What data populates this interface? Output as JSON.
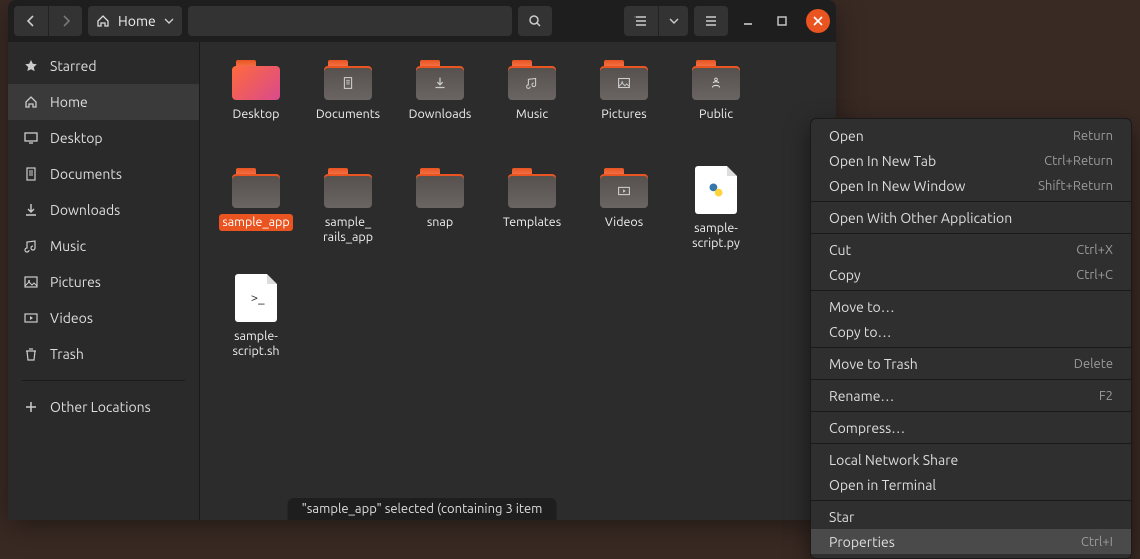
{
  "path": {
    "label": "Home"
  },
  "sidebar": {
    "items": [
      {
        "label": "Starred",
        "icon": "star"
      },
      {
        "label": "Home",
        "icon": "home",
        "active": true
      },
      {
        "label": "Desktop",
        "icon": "desktop"
      },
      {
        "label": "Documents",
        "icon": "documents"
      },
      {
        "label": "Downloads",
        "icon": "downloads"
      },
      {
        "label": "Music",
        "icon": "music"
      },
      {
        "label": "Pictures",
        "icon": "pictures"
      },
      {
        "label": "Videos",
        "icon": "videos"
      },
      {
        "label": "Trash",
        "icon": "trash"
      }
    ],
    "other": {
      "label": "Other Locations"
    }
  },
  "grid": {
    "items": [
      {
        "label": "Desktop",
        "type": "folder-special"
      },
      {
        "label": "Documents",
        "type": "folder",
        "glyph": "documents"
      },
      {
        "label": "Downloads",
        "type": "folder",
        "glyph": "downloads"
      },
      {
        "label": "Music",
        "type": "folder",
        "glyph": "music"
      },
      {
        "label": "Pictures",
        "type": "folder",
        "glyph": "pictures"
      },
      {
        "label": "Public",
        "type": "folder",
        "glyph": "public"
      },
      {
        "label": "sample_app",
        "type": "folder",
        "selected": true
      },
      {
        "label": "sample_rails_app",
        "type": "folder"
      },
      {
        "label": "snap",
        "type": "folder"
      },
      {
        "label": "Templates",
        "type": "folder"
      },
      {
        "label": "Videos",
        "type": "folder",
        "glyph": "videos"
      },
      {
        "label": "sample-script.py",
        "type": "file",
        "glyph": "python"
      },
      {
        "label": "sample-script.sh",
        "type": "file",
        "glyph": "shell"
      }
    ]
  },
  "statusbar": {
    "text": "\"sample_app\" selected  (containing 3 item"
  },
  "context_menu": {
    "groups": [
      [
        {
          "label": "Open",
          "shortcut": "Return"
        },
        {
          "label": "Open In New Tab",
          "shortcut": "Ctrl+Return"
        },
        {
          "label": "Open In New Window",
          "shortcut": "Shift+Return"
        }
      ],
      [
        {
          "label": "Open With Other Application"
        }
      ],
      [
        {
          "label": "Cut",
          "shortcut": "Ctrl+X"
        },
        {
          "label": "Copy",
          "shortcut": "Ctrl+C"
        }
      ],
      [
        {
          "label": "Move to…"
        },
        {
          "label": "Copy to…"
        }
      ],
      [
        {
          "label": "Move to Trash",
          "shortcut": "Delete"
        }
      ],
      [
        {
          "label": "Rename…",
          "shortcut": "F2"
        }
      ],
      [
        {
          "label": "Compress…"
        }
      ],
      [
        {
          "label": "Local Network Share"
        },
        {
          "label": "Open in Terminal"
        }
      ],
      [
        {
          "label": "Star"
        },
        {
          "label": "Properties",
          "shortcut": "Ctrl+I",
          "highlight": true
        }
      ]
    ]
  }
}
